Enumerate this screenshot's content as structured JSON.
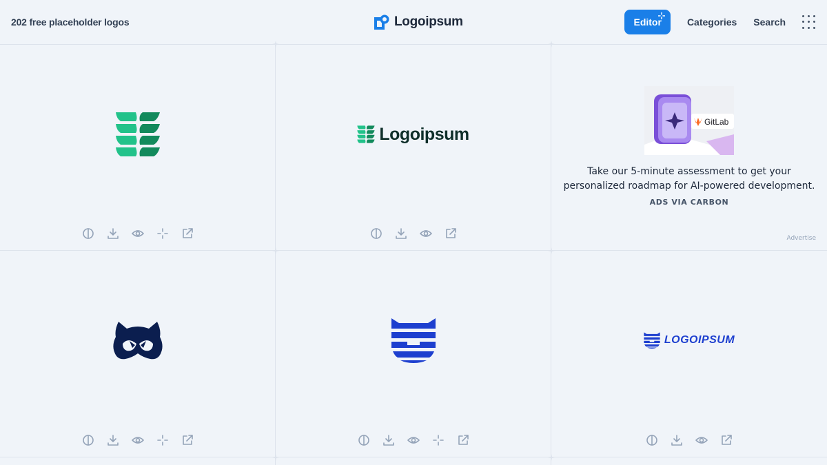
{
  "header": {
    "tagline": "202 free placeholder logos",
    "brand": "Logoipsum",
    "nav": {
      "editor": "Editor",
      "categories": "Categories",
      "search": "Search"
    },
    "accent": "#1a7fe8"
  },
  "cells": [
    {
      "logo_icon": "green-leaf-stack-icon",
      "actions": [
        "contrast-icon",
        "download-icon",
        "eye-icon",
        "sparkle-icon",
        "external-link-icon"
      ]
    },
    {
      "logo_icon": "green-leaf-wordmark-icon",
      "wordmark": "Logoipsum",
      "actions": [
        "contrast-icon",
        "download-icon",
        "eye-icon",
        "external-link-icon"
      ]
    },
    {
      "ad": {
        "image_label": "GitLab",
        "text": "Take our 5-minute assessment to get your personalized roadmap for AI-powered development.",
        "via": "ADS VIA CARBON",
        "advertise": "Advertise"
      }
    },
    {
      "logo_icon": "navy-raccoon-icon",
      "actions": [
        "contrast-icon",
        "download-icon",
        "eye-icon",
        "sparkle-icon",
        "external-link-icon"
      ]
    },
    {
      "logo_icon": "blue-striped-cat-icon",
      "actions": [
        "contrast-icon",
        "download-icon",
        "eye-icon",
        "sparkle-icon",
        "external-link-icon"
      ]
    },
    {
      "logo_icon": "blue-striped-wordmark-icon",
      "wordmark": "LOGOIPSUM",
      "actions": [
        "contrast-icon",
        "download-icon",
        "eye-icon",
        "external-link-icon"
      ]
    }
  ]
}
